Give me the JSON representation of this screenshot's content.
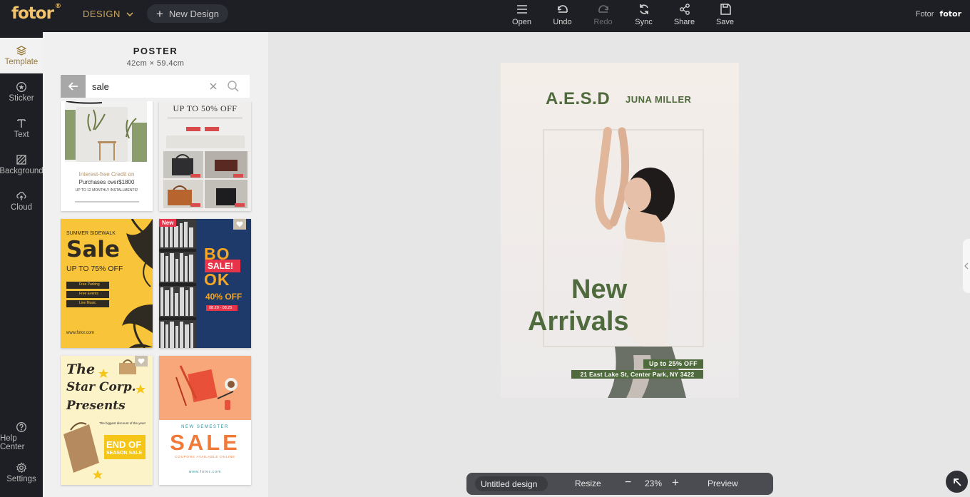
{
  "topbar": {
    "logo": "fotor",
    "logo_mark": "®",
    "design_menu": "DESIGN",
    "new_design": "New Design",
    "tools": [
      {
        "label": "Open",
        "icon": "menu-icon",
        "enabled": true
      },
      {
        "label": "Undo",
        "icon": "undo-icon",
        "enabled": true
      },
      {
        "label": "Redo",
        "icon": "redo-icon",
        "enabled": false
      },
      {
        "label": "Sync",
        "icon": "sync-icon",
        "enabled": true
      },
      {
        "label": "Share",
        "icon": "share-icon",
        "enabled": true
      },
      {
        "label": "Save",
        "icon": "save-icon",
        "enabled": true
      }
    ],
    "account_label": "Fotor",
    "account_mark": "fotor"
  },
  "leftnav": {
    "items": [
      {
        "label": "Template",
        "icon": "template-icon",
        "active": true
      },
      {
        "label": "Sticker",
        "icon": "sticker-icon",
        "active": false
      },
      {
        "label": "Text",
        "icon": "text-icon",
        "active": false
      },
      {
        "label": "Background",
        "icon": "background-icon",
        "active": false
      },
      {
        "label": "Cloud",
        "icon": "cloud-icon",
        "active": false
      }
    ],
    "bottom_items": [
      {
        "label": "Help Center",
        "icon": "help-icon"
      },
      {
        "label": "Settings",
        "icon": "settings-icon"
      }
    ]
  },
  "panel": {
    "title": "POSTER",
    "size": "42cm × 59.4cm",
    "search_value": "sale",
    "templates": [
      {
        "name": "summer-sale",
        "lines": [
          "Interest-free Credit on",
          "Purchases over$1800",
          "UP TO 12 MONTHLY INSTALLMENTS!"
        ]
      },
      {
        "name": "bags-sale",
        "lines": [
          "UP TO 50% OFF"
        ]
      },
      {
        "name": "summer-sidewalk-sale",
        "lines": [
          "SUMMER SIDEWALK",
          "Sale",
          "UP TO 75% OFF",
          "Free Parking",
          "Free Events",
          "Live Music",
          "www.fotor.com"
        ]
      },
      {
        "name": "book-sale",
        "badge": "New",
        "lines": [
          "BO",
          "SALE!",
          "OK",
          "40% OFF",
          "08.20 - 08.25"
        ]
      },
      {
        "name": "star-corp",
        "lines": [
          "The",
          "Star Corp.",
          "Presents",
          "The biggest discount of the year!",
          "END OF",
          "SEASON SALE"
        ]
      },
      {
        "name": "semester-sale",
        "lines": [
          "NEW SEMESTER",
          "SALE",
          "COUPONS AVAILABLE ONLINE",
          "www.fotor.com"
        ]
      }
    ]
  },
  "poster": {
    "brand": "A.E.S.D",
    "author": "JUNA MILLER",
    "headline_1": "New",
    "headline_2": "Arrivals",
    "offer": "Up to 25% OFF",
    "address": "21 East Lake St, Center Park, NY 3422"
  },
  "bottombar": {
    "doc_title": "Untitled design",
    "resize": "Resize",
    "zoom": "23%",
    "preview": "Preview"
  },
  "colors": {
    "topbar": "#1d1f24",
    "accent_gold": "#c8a560",
    "poster_green": "#4f6a3c",
    "new_badge": "#e8344a"
  }
}
